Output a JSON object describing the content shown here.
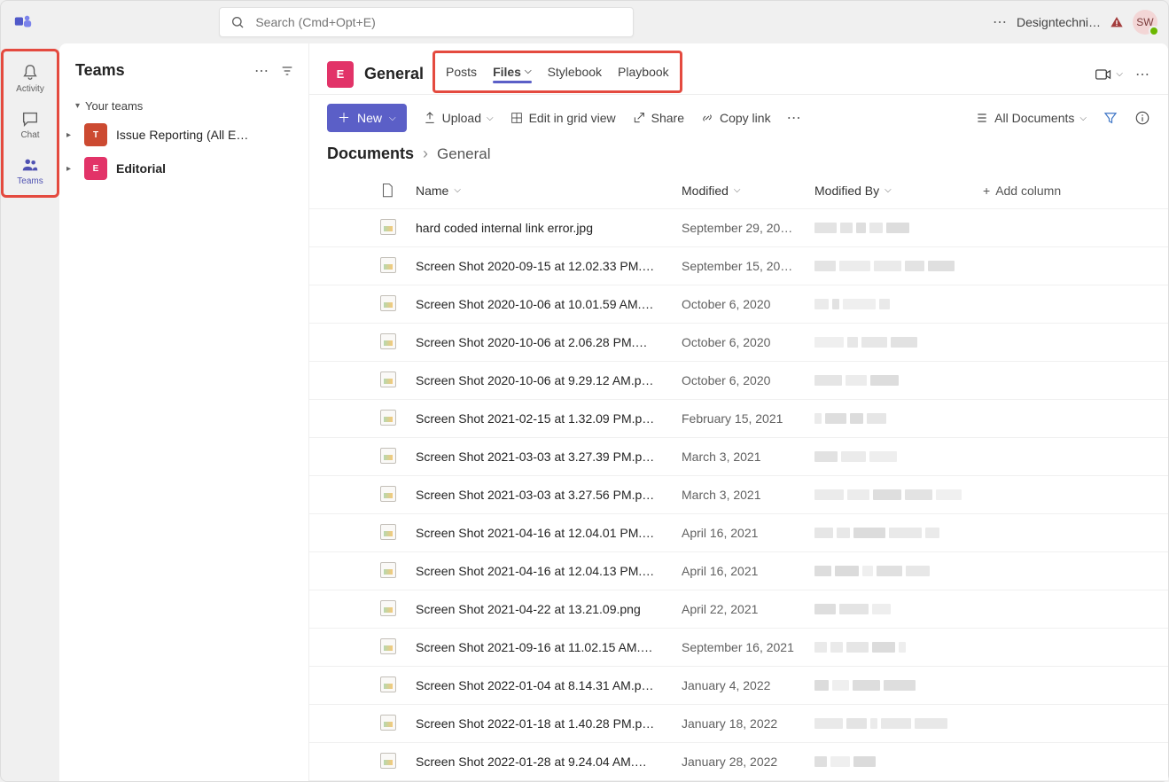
{
  "topbar": {
    "search_placeholder": "Search (Cmd+Opt+E)",
    "org_label": "Designtechni…",
    "avatar_initials": "SW"
  },
  "rail": {
    "items": [
      {
        "label": "Activity"
      },
      {
        "label": "Chat"
      },
      {
        "label": "Teams"
      }
    ]
  },
  "sidebar": {
    "title": "Teams",
    "section_label": "Your teams",
    "teams": [
      {
        "initial": "T",
        "name": "Issue Reporting (All E…",
        "color": "#cc4a31"
      },
      {
        "initial": "E",
        "name": "Editorial",
        "color": "#e23368"
      }
    ]
  },
  "channel": {
    "badge_initial": "E",
    "title": "General",
    "tabs": [
      "Posts",
      "Files",
      "Stylebook",
      "Playbook"
    ],
    "active_tab_index": 1
  },
  "toolbar": {
    "new_label": "New",
    "upload_label": "Upload",
    "grid_label": "Edit in grid view",
    "share_label": "Share",
    "copylink_label": "Copy link",
    "view_label": "All Documents"
  },
  "breadcrumb": {
    "root": "Documents",
    "current": "General"
  },
  "table": {
    "headers": {
      "name": "Name",
      "modified": "Modified",
      "modified_by": "Modified By",
      "add_column": "Add column"
    },
    "rows": [
      {
        "name": "hard coded internal link error.jpg",
        "modified": "September 29, 20…"
      },
      {
        "name": "Screen Shot 2020-09-15 at 12.02.33 PM.…",
        "modified": "September 15, 20…"
      },
      {
        "name": "Screen Shot 2020-10-06 at 10.01.59 AM.…",
        "modified": "October 6, 2020"
      },
      {
        "name": "Screen Shot 2020-10-06 at 2.06.28 PM.…",
        "modified": "October 6, 2020"
      },
      {
        "name": "Screen Shot 2020-10-06 at 9.29.12 AM.p…",
        "modified": "October 6, 2020"
      },
      {
        "name": "Screen Shot 2021-02-15 at 1.32.09 PM.p…",
        "modified": "February 15, 2021"
      },
      {
        "name": "Screen Shot 2021-03-03 at 3.27.39 PM.p…",
        "modified": "March 3, 2021"
      },
      {
        "name": "Screen Shot 2021-03-03 at 3.27.56 PM.p…",
        "modified": "March 3, 2021"
      },
      {
        "name": "Screen Shot 2021-04-16 at 12.04.01 PM.…",
        "modified": "April 16, 2021"
      },
      {
        "name": "Screen Shot 2021-04-16 at 12.04.13 PM.…",
        "modified": "April 16, 2021"
      },
      {
        "name": "Screen Shot 2021-04-22 at 13.21.09.png",
        "modified": "April 22, 2021"
      },
      {
        "name": "Screen Shot 2021-09-16 at 11.02.15 AM.…",
        "modified": "September 16, 2021"
      },
      {
        "name": "Screen Shot 2022-01-04 at 8.14.31 AM.p…",
        "modified": "January 4, 2022"
      },
      {
        "name": "Screen Shot 2022-01-18 at 1.40.28 PM.p…",
        "modified": "January 18, 2022"
      },
      {
        "name": "Screen Shot 2022-01-28 at 9.24.04 AM.…",
        "modified": "January 28, 2022"
      }
    ]
  }
}
